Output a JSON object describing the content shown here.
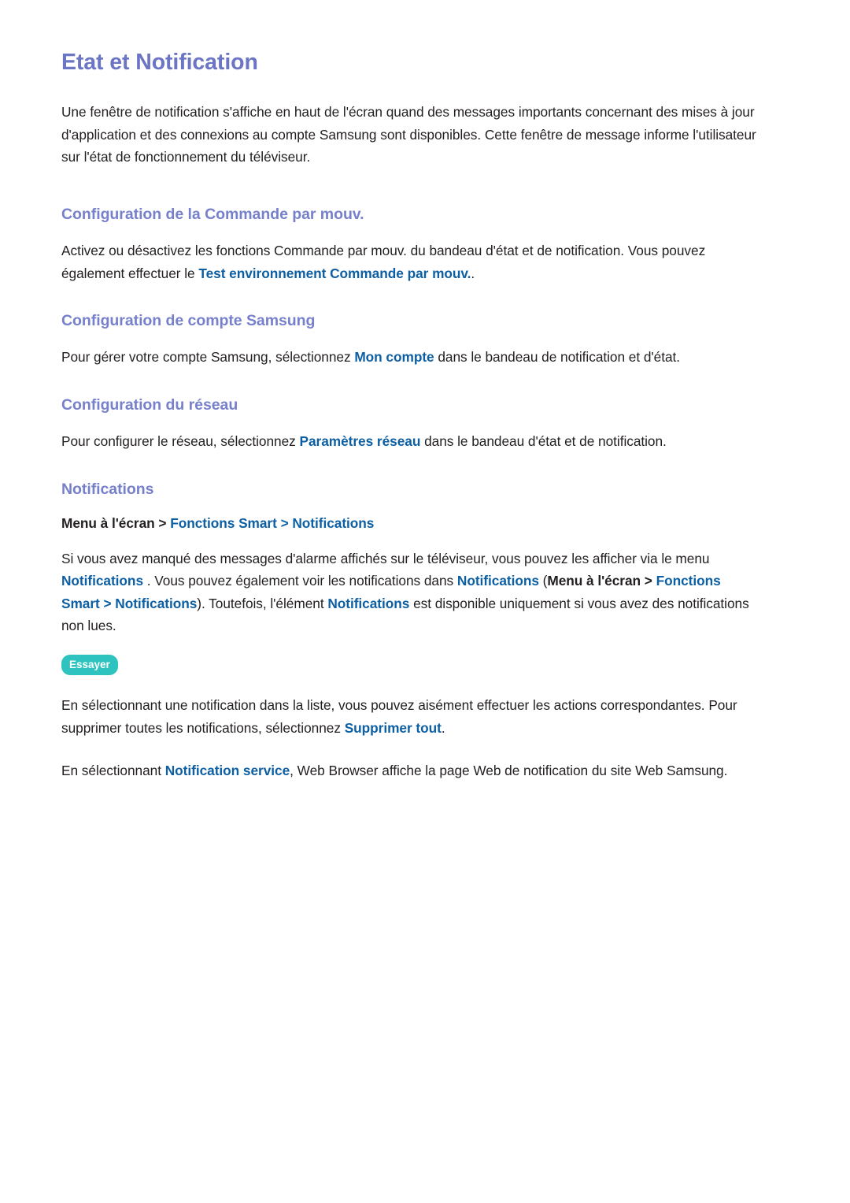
{
  "document": {
    "title": "Etat et Notification",
    "intro": "Une fenêtre de notification s'affiche en haut de l'écran quand des messages importants concernant des mises à jour d'application et des connexions au compte Samsung sont disponibles. Cette fenêtre de message informe l'utilisateur sur l'état de fonctionnement du téléviseur."
  },
  "colors": {
    "title": "#6b75c4",
    "heading": "#7680cb",
    "link": "#0d5fa4",
    "body": "#231f20",
    "badge_background": "#2ec3bf",
    "badge_text": "#ffffff",
    "page_background": "#ffffff"
  },
  "sections": {
    "motion_control": {
      "heading": "Configuration de la Commande par mouv.",
      "paragraph_part1": "Activez ou désactivez les fonctions Commande par mouv. du bandeau d'état et de notification. Vous pouvez également effectuer le ",
      "link": "Test environnement Commande par mouv.",
      "paragraph_part2": "."
    },
    "samsung_account": {
      "heading": "Configuration de compte Samsung",
      "paragraph_part1": "Pour gérer votre compte Samsung, sélectionnez ",
      "link": "Mon compte",
      "paragraph_part2": " dans le bandeau de notification et d'état."
    },
    "network": {
      "heading": "Configuration du réseau",
      "paragraph_part1": "Pour configurer le réseau, sélectionnez ",
      "link": "Paramètres réseau",
      "paragraph_part2": " dans le bandeau d'état et de notification."
    },
    "notifications": {
      "heading": "Notifications",
      "breadcrumb": {
        "root": "Menu à l'écran",
        "sep1": " > ",
        "item1": "Fonctions Smart",
        "sep2": " > ",
        "item2": "Notifications"
      },
      "paragraph1": {
        "t1": "Si vous avez manqué des messages d'alarme affichés sur le téléviseur, vous pouvez les afficher via le menu ",
        "l1": "Notifications",
        "t2": " . Vous pouvez également voir les notifications dans ",
        "l2": "Notifications",
        "t3": " (",
        "b1": "Menu à l'écran",
        "t4": " > ",
        "l3": "Fonctions Smart",
        "t5": " > ",
        "l4": "Notifications",
        "t6": "). Toutefois, l'élément ",
        "l5": "Notifications",
        "t7": " est disponible uniquement si vous avez des notifications non lues."
      },
      "try_badge": "Essayer",
      "paragraph2": {
        "t1": "En sélectionnant une notification dans la liste, vous pouvez aisément effectuer les actions correspondantes. Pour supprimer toutes les notifications, sélectionnez ",
        "l1": "Supprimer tout",
        "t2": "."
      },
      "paragraph3": {
        "t1": "En sélectionnant ",
        "l1": "Notification service",
        "t2": ", Web Browser affiche la page Web de notification du site Web Samsung."
      }
    }
  }
}
